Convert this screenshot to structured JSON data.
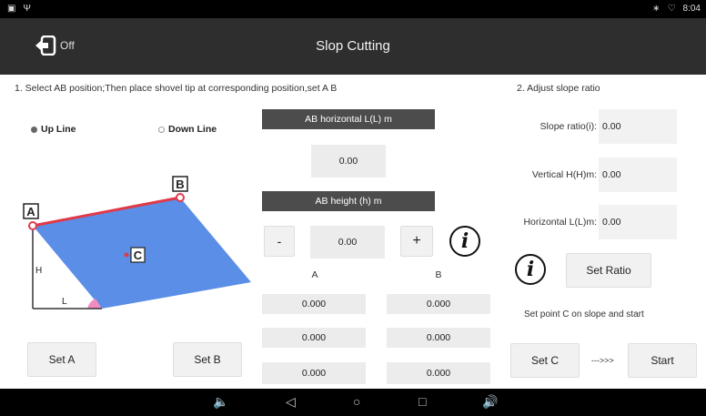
{
  "status": {
    "time": "8:04"
  },
  "header": {
    "back_label": "Off",
    "title": "Slop Cutting"
  },
  "section1": {
    "instruction": "1. Select AB position;Then place shovel tip at corresponding position,set A B",
    "up_line": "Up Line",
    "down_line": "Down Line",
    "selected_line": "Up Line"
  },
  "diagram": {
    "label_a": "A",
    "label_b": "B",
    "label_c": "C",
    "label_h": "H",
    "label_l": "L",
    "slope_color": "#5b8ee6",
    "line_color": "#e03a4a"
  },
  "middle": {
    "ab_horizontal_label": "AB horizontal L(L) m",
    "ab_horizontal_value": "0.00",
    "ab_height_label": "AB height (h) m",
    "ab_height_value": "0.00",
    "minus": "-",
    "plus": "+",
    "col_a": "A",
    "col_b": "B",
    "rows": [
      {
        "a": "0.000",
        "b": "0.000"
      },
      {
        "a": "0.000",
        "b": "0.000"
      },
      {
        "a": "0.000",
        "b": "0.000"
      }
    ]
  },
  "section2": {
    "title": "2. Adjust slope ratio",
    "slope_ratio_label": "Slope ratio(i):",
    "slope_ratio_value": "0.00",
    "vertical_label": "Vertical H(H)m:",
    "vertical_value": "0.00",
    "horizontal_label": "Horizontal L(L)m:",
    "horizontal_value": "0.00",
    "set_ratio": "Set Ratio",
    "note": "Set point C on slope and start",
    "arrow": "--->>>"
  },
  "buttons": {
    "set_a": "Set A",
    "set_b": "Set B",
    "set_c": "Set C",
    "start": "Start"
  },
  "info_glyph": "i"
}
